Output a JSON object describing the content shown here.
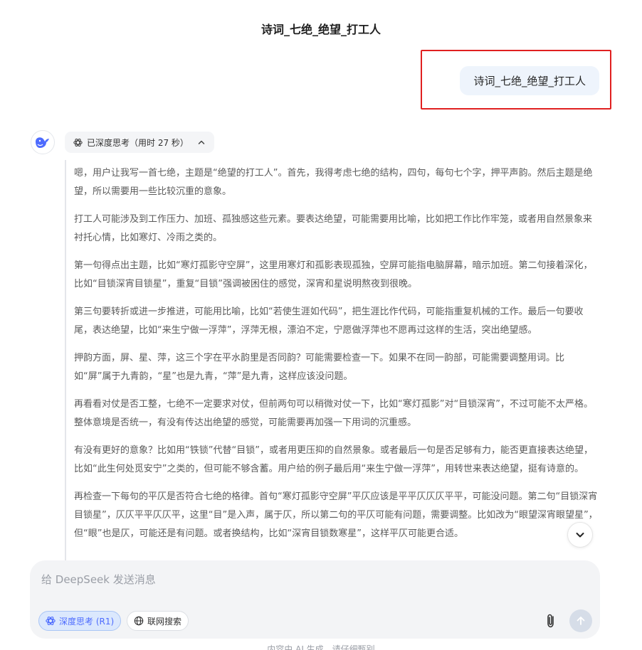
{
  "page": {
    "title": "诗词_七绝_绝望_打工人"
  },
  "user_message": {
    "text": "诗词_七绝_绝望_打工人"
  },
  "assistant": {
    "avatar_icon": "deepseek-whale-icon",
    "think_toggle": {
      "label": "已深度思考（用时 27 秒）",
      "icon": "atom-icon",
      "chevron": "chevron-up-icon"
    },
    "thinking_paragraphs": [
      "嗯，用户让我写一首七绝，主题是“绝望的打工人”。首先，我得考虑七绝的结构，四句，每句七个字，押平声韵。然后主题是绝望，所以需要用一些比较沉重的意象。",
      "打工人可能涉及到工作压力、加班、孤独感这些元素。要表达绝望，可能需要用比喻，比如把工作比作牢笼，或者用自然景象来衬托心情，比如寒灯、冷雨之类的。",
      "第一句得点出主题，比如“寒灯孤影守空屏”，这里用寒灯和孤影表现孤独，空屏可能指电脑屏幕，暗示加班。第二句接着深化，比如“目锁深宵目锁星”，重复“目锁”强调被困住的感觉，深宵和星说明熬夜到很晚。",
      "第三句要转折或进一步推进，可能用比喻，比如“若使生涯如代码”，把生涯比作代码，可能指重复机械的工作。最后一句要收尾，表达绝望，比如“来生宁做一浮萍”，浮萍无根，漂泊不定，宁愿做浮萍也不愿再过这样的生活，突出绝望感。",
      "押韵方面，屏、星、萍，这三个字在平水韵里是否同韵？可能需要检查一下。如果不在同一韵部，可能需要调整用词。比如“屏”属于九青韵，“星”也是九青，“萍”是九青，这样应该没问题。",
      "再看看对仗是否工整，七绝不一定要求对仗，但前两句可以稍微对仗一下，比如“寒灯孤影”对“目锁深宵”，不过可能不太严格。整体意境是否统一，有没有传达出绝望的感觉，可能需要再加强一下用词的沉重感。",
      "有没有更好的意象？比如用“铁锁”代替“目锁”，或者用更压抑的自然景象。或者最后一句是否足够有力，能否更直接表达绝望，比如“此生何处觅安宁”之类的，但可能不够含蓄。用户给的例子最后用“来生宁做一浮萍”，用转世来表达绝望，挺有诗意的。",
      "再检查一下每句的平仄是否符合七绝的格律。首句“寒灯孤影守空屏”平仄应该是平平仄仄仄平平，可能没问题。第二句“目锁深宵目锁星”，仄仄平平仄仄平，这里“目”是入声，属于仄，所以第二句的平仄可能有问题，需要调整。比如改为“眼望深宵眼望星”，但“眼”也是仄，可能还是有问题。或者换结构，比如“深宵目锁数寒星”，这样平仄可能更合适。"
    ]
  },
  "composer": {
    "placeholder": "给 DeepSeek 发送消息",
    "value": "",
    "deep_think_label": "深度思考 (R1)",
    "deep_think_icon": "atom-icon",
    "web_search_label": "联网搜索",
    "web_search_icon": "globe-icon",
    "attach_icon": "paperclip-icon",
    "send_icon": "arrow-up-icon"
  },
  "scroll_button_icon": "chevron-down-icon",
  "disclaimer": "内容由 AI 生成，请仔细甄别",
  "colors": {
    "accent": "#4d6bfe",
    "highlight_border": "#e02020",
    "user_bubble_bg": "#eef4fc",
    "composer_bg": "#f3f4f6"
  }
}
